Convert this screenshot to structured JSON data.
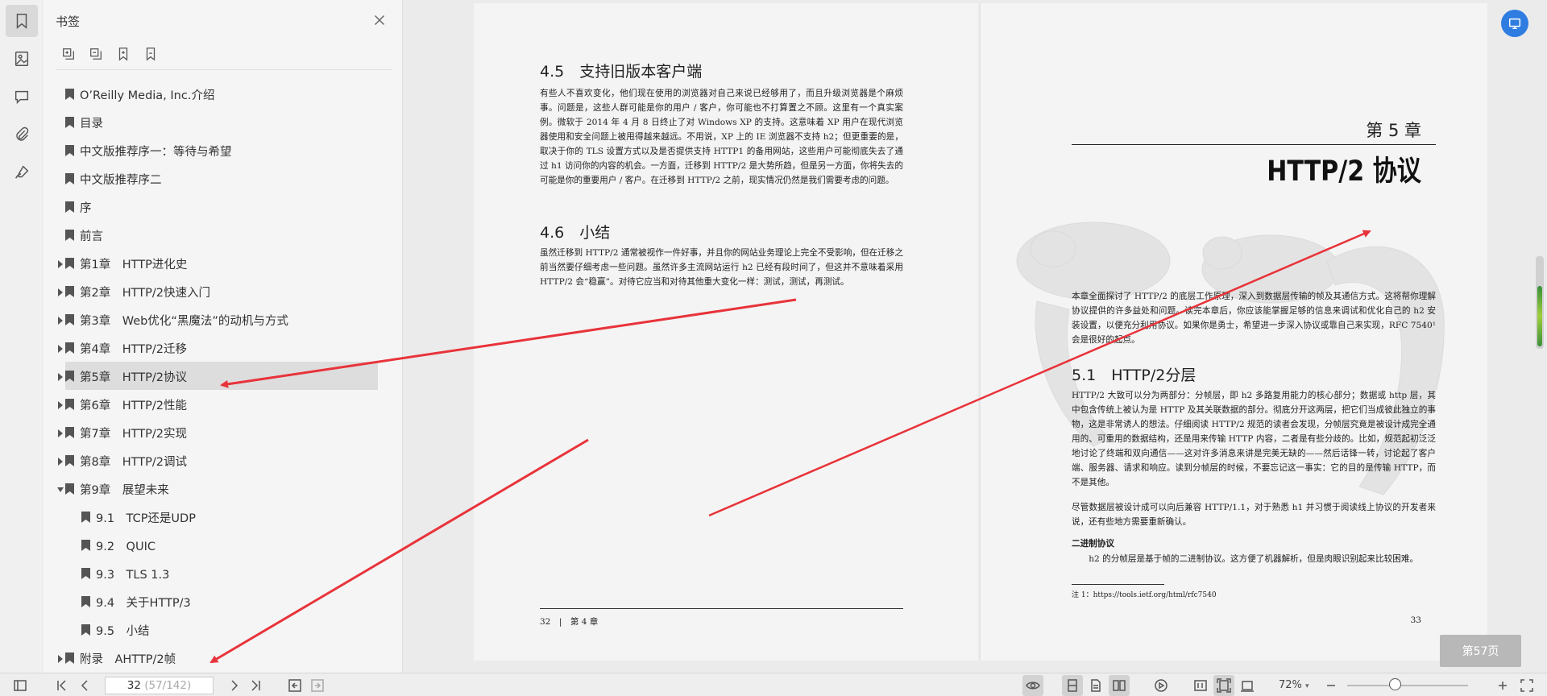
{
  "sidebar_panel": {
    "title": "书签",
    "items": [
      {
        "label": "O’Reilly Media, Inc.介绍",
        "level": 0,
        "expand": "none"
      },
      {
        "label": "目录",
        "level": 0,
        "expand": "none"
      },
      {
        "label": "中文版推荐序一：等待与希望",
        "level": 0,
        "expand": "none"
      },
      {
        "label": "中文版推荐序二",
        "level": 0,
        "expand": "none"
      },
      {
        "label": "序",
        "level": 0,
        "expand": "none"
      },
      {
        "label": "前言",
        "level": 0,
        "expand": "none"
      },
      {
        "label": "第1章　HTTP进化史",
        "level": 0,
        "expand": "collapsed"
      },
      {
        "label": "第2章　HTTP/2快速入门",
        "level": 0,
        "expand": "collapsed"
      },
      {
        "label": "第3章　Web优化“黑魔法”的动机与方式",
        "level": 0,
        "expand": "collapsed"
      },
      {
        "label": "第4章　HTTP/2迁移",
        "level": 0,
        "expand": "collapsed"
      },
      {
        "label": "第5章　HTTP/2协议",
        "level": 0,
        "expand": "collapsed",
        "selected": true
      },
      {
        "label": "第6章　HTTP/2性能",
        "level": 0,
        "expand": "collapsed"
      },
      {
        "label": "第7章　HTTP/2实现",
        "level": 0,
        "expand": "collapsed"
      },
      {
        "label": "第8章　HTTP/2调试",
        "level": 0,
        "expand": "collapsed"
      },
      {
        "label": "第9章　展望未来",
        "level": 0,
        "expand": "expanded"
      },
      {
        "label": "9.1　TCP还是UDP",
        "level": 1,
        "expand": "none"
      },
      {
        "label": "9.2　QUIC",
        "level": 1,
        "expand": "none"
      },
      {
        "label": "9.3　TLS 1.3",
        "level": 1,
        "expand": "none"
      },
      {
        "label": "9.4　关于HTTP/3",
        "level": 1,
        "expand": "none"
      },
      {
        "label": "9.5　小结",
        "level": 1,
        "expand": "none"
      },
      {
        "label": "附录　AHTTP/2帧",
        "level": 0,
        "expand": "collapsed"
      }
    ]
  },
  "left_page": {
    "heading1": "4.5　支持旧版本客户端",
    "para1": "有些人不喜欢变化，他们现在使用的浏览器对自己来说已经够用了，而且升级浏览器是个麻烦事。问题是，这些人群可能是你的用户 / 客户，你可能也不打算置之不顾。这里有一个真实案例。微软于 2014 年 4 月 8 日终止了对 Windows XP 的支持。这意味着 XP 用户在现代浏览器使用和安全问题上被甩得越来越远。不用说，XP 上的 IE 浏览器不支持 h2；但更重要的是，取决于你的 TLS 设置方式以及是否提供支持 HTTP1 的备用网站，这些用户可能彻底失去了通过 h1 访问你的内容的机会。一方面，迁移到 HTTP/2 是大势所趋，但是另一方面，你将失去的可能是你的重要用户 / 客户。在迁移到 HTTP/2 之前，现实情况仍然是我们需要考虑的问题。",
    "heading2": "4.6　小结",
    "para2": "虽然迁移到 HTTP/2 通常被视作一件好事，并且你的网站业务理论上完全不受影响，但在迁移之前当然要仔细考虑一些问题。虽然许多主流网站运行 h2 已经有段时间了，但这并不意味着采用 HTTP/2 会“稳赢”。对待它应当和对待其他重大变化一样：测试，测试，再测试。",
    "footer": "32　|　第 4 章"
  },
  "right_page": {
    "chapter_number": "第 5 章",
    "chapter_title": "HTTP/2 协议",
    "para1": "本章全面探讨了 HTTP/2 的底层工作原理，深入到数据层传输的帧及其通信方式。这将帮你理解协议提供的许多益处和问题。读完本章后，你应该能掌握足够的信息来调试和优化自己的 h2 安装设置，以便充分利用协议。如果你是勇士，希望进一步深入协议或靠自己来实现，RFC 7540¹ 会是很好的起点。",
    "heading1": "5.1　HTTP/2分层",
    "para2": "HTTP/2 大致可以分为两部分：分帧层，即 h2 多路复用能力的核心部分；数据或 http 层，其中包含传统上被认为是 HTTP 及其关联数据的部分。彻底分开这两层，把它们当成彼此独立的事物，这是非常诱人的想法。仔细阅读 HTTP/2 规范的读者会发现，分帧层究竟是被设计成完全通用的、可重用的数据结构，还是用来传输 HTTP 内容，二者是有些分歧的。比如，规范起初泛泛地讨论了终端和双向通信——这对许多消息来讲是完美无缺的——然后话锋一转，讨论起了客户端、服务器、请求和响应。读到分帧层的时候，不要忘记这一事实：它的目的是传输 HTTP，而不是其他。",
    "para3": "尽管数据层被设计成可以向后兼容 HTTP/1.1，对于熟悉 h1 并习惯于阅读线上协议的开发者来说，还有些地方需要重新确认。",
    "subheading": "二进制协议",
    "para4": "h2 的分帧层是基于帧的二进制协议。这方便了机器解析，但是肉眼识别起来比较困难。",
    "footnote": "注 1：https://tools.ietf.org/html/rfc7540",
    "page_number": "33"
  },
  "page_badge": "第57页",
  "statusbar": {
    "page_current": "32",
    "page_total": " (57/142)",
    "zoom": "72%"
  },
  "colors": {
    "annotation_arrow": "#e8333a",
    "accent_blue": "#2f7de1",
    "selected_row": "#dddddd"
  },
  "icons": [
    "bookmark-icon",
    "thumbnail-icon",
    "comment-icon",
    "attachment-icon",
    "sign-icon",
    "close-icon",
    "expand-all-icon",
    "collapse-all-icon",
    "add-bookmark-icon",
    "bookmark-outline-icon"
  ]
}
